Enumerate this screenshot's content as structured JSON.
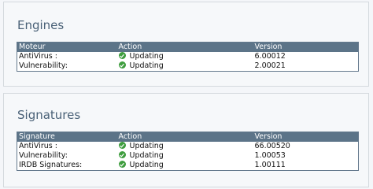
{
  "engines": {
    "title": "Engines",
    "columns": [
      "Moteur",
      "Action",
      "Version"
    ],
    "rows": [
      {
        "name": "AntiVirus :",
        "action": "Updating",
        "version": "6.00012"
      },
      {
        "name": "Vulnerability:",
        "action": "Updating",
        "version": "2.00021"
      }
    ]
  },
  "signatures": {
    "title": "Signatures",
    "columns": [
      "Signature",
      "Action",
      "Version"
    ],
    "rows": [
      {
        "name": "AntiVirus :",
        "action": "Updating",
        "version": "66.00520"
      },
      {
        "name": "Vulnerability:",
        "action": "Updating",
        "version": "1.00053"
      },
      {
        "name": "IRDB Signatures:",
        "action": "Updating",
        "version": "1.00111"
      }
    ]
  },
  "colors": {
    "header_bg": "#5c7488",
    "title": "#4a6177",
    "check": "#3e9d3e"
  },
  "icons": {
    "status": "check-circle-icon"
  }
}
